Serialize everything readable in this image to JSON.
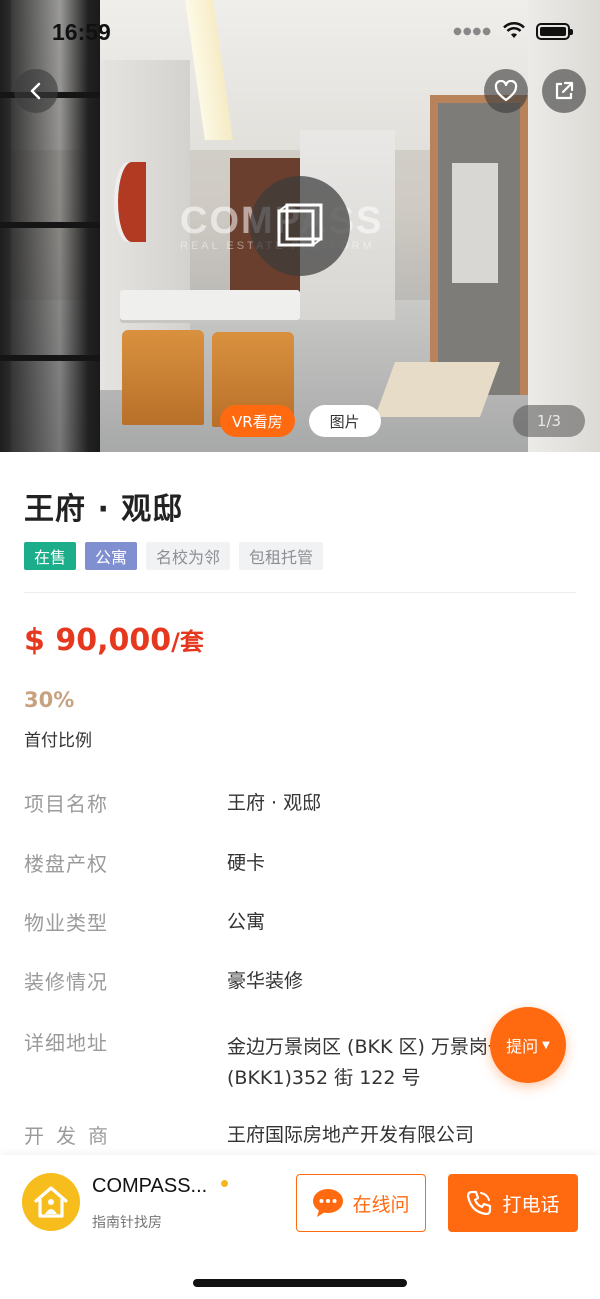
{
  "status_bar": {
    "time": "16:59"
  },
  "hero": {
    "watermark": "COMPASS",
    "watermark_sub": "REAL ESTATE PLATFORM",
    "media_tabs": [
      {
        "label": "VR看房",
        "active": true
      },
      {
        "label": "图片",
        "active": false
      }
    ],
    "counter": "1/3"
  },
  "property": {
    "title": "王府 · 观邸",
    "tags": [
      "在售",
      "公寓",
      "名校为邻",
      "包租托管"
    ],
    "price": {
      "amount": "$ 90,000",
      "unit": "/套"
    },
    "down_payment": {
      "value": "30%",
      "label": "首付比例"
    },
    "info": [
      {
        "label": "项目名称",
        "value": "王府 · 观邸"
      },
      {
        "label": "楼盘产权",
        "value": "硬卡"
      },
      {
        "label": "物业类型",
        "value": "公寓"
      },
      {
        "label": "装修情况",
        "value": "豪华装修"
      },
      {
        "label": "详细地址",
        "value": "金边万景岗区 (BKK 区) 万景岗一区 (BKK1)352 街 122 号"
      },
      {
        "label": "开发商",
        "value": "王府国际房地产开发有限公司"
      }
    ]
  },
  "ask_button": {
    "label": "提问"
  },
  "bottom_bar": {
    "agent_name": "COMPASS...",
    "agent_sub": "指南针找房",
    "chat_label": "在线问",
    "call_label": "打电话"
  },
  "colors": {
    "accent": "#ff6a10",
    "price": "#e5381e",
    "tag_sale": "#1cae8a",
    "tag_type": "#7f8fd0",
    "ratio": "#c6a27f",
    "avatar": "#f7bd1c"
  }
}
